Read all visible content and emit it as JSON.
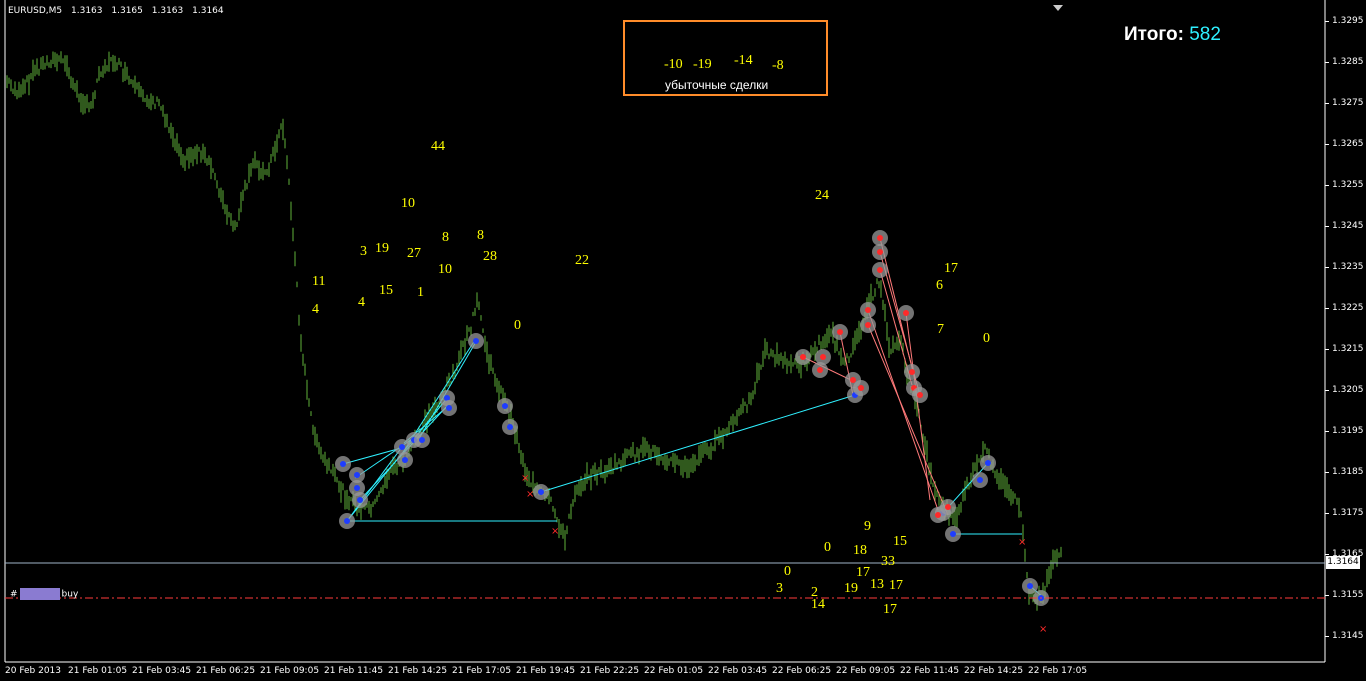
{
  "header": {
    "symbol": "EURUSD,M5",
    "open": "1.3163",
    "high": "1.3165",
    "low": "1.3163",
    "close": "1.3164"
  },
  "total": {
    "label": "Итого:",
    "value": "582"
  },
  "losing_trades": {
    "label": "убыточные сделки",
    "values": [
      "-10",
      "-19",
      "-14",
      "-8"
    ]
  },
  "price_axis": {
    "ticks": [
      "1.3295",
      "1.3285",
      "1.3275",
      "1.3265",
      "1.3255",
      "1.3245",
      "1.3235",
      "1.3225",
      "1.3215",
      "1.3205",
      "1.3195",
      "1.3185",
      "1.3175",
      "1.3165",
      "1.3155",
      "1.3145"
    ],
    "current": "1.3164"
  },
  "time_axis": {
    "ticks": [
      "20 Feb 2013",
      "21 Feb 01:05",
      "21 Feb 03:45",
      "21 Feb 06:25",
      "21 Feb 09:05",
      "21 Feb 11:45",
      "21 Feb 14:25",
      "21 Feb 17:05",
      "21 Feb 19:45",
      "21 Feb 22:25",
      "22 Feb 01:05",
      "22 Feb 03:45",
      "22 Feb 06:25",
      "22 Feb 09:05",
      "22 Feb 11:45",
      "22 Feb 14:25",
      "22 Feb 17:05"
    ]
  },
  "order_label": {
    "prefix": "#",
    "suffix": "buy"
  },
  "profit_labels": [
    "44",
    "10",
    "8",
    "8",
    "3",
    "19",
    "27",
    "28",
    "10",
    "11",
    "15",
    "1",
    "4",
    "4",
    "22",
    "0",
    "24",
    "17",
    "6",
    "7",
    "0",
    "9",
    "0",
    "18",
    "15",
    "33",
    "0",
    "17",
    "3",
    "2",
    "19",
    "13",
    "17",
    "14",
    "17"
  ],
  "colors": {
    "candles": "#5fb23a",
    "buy_lines": "#2ff0ff",
    "sell_lines": "#ff7a7a",
    "labels": "#ffff00",
    "frame": "#ff8c2a",
    "total_value": "#2ff0ff"
  }
}
